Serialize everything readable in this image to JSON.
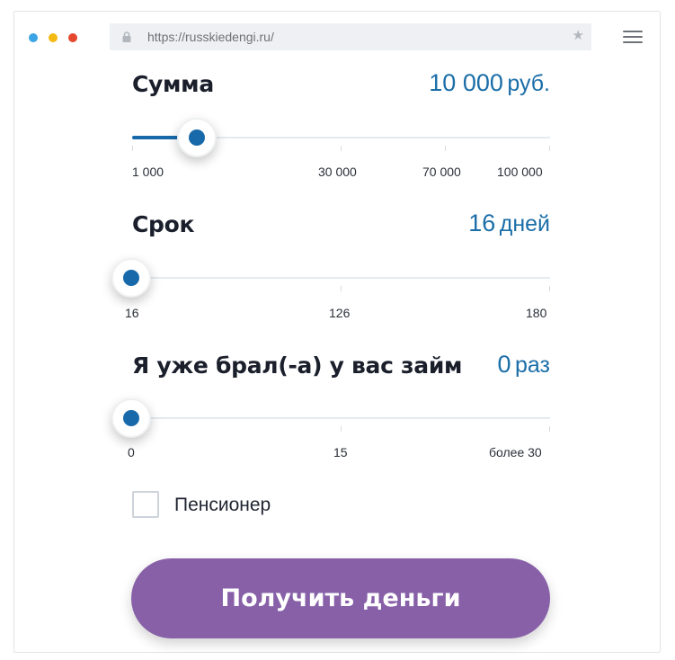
{
  "browser": {
    "url": "https://russkiedengi.ru/",
    "lock_icon": "lock-icon",
    "bookmark_icon": "star-icon",
    "menu_icon": "hamburger-menu-icon",
    "window_dots": [
      "#3ba4e4",
      "#f5b914",
      "#e5462e"
    ]
  },
  "calculator": {
    "amount": {
      "label": "Сумма",
      "value": "10 000",
      "unit": "руб.",
      "slider_value": 10000,
      "ticks": [
        "1 000",
        "30 000",
        "70 000",
        "100 000"
      ]
    },
    "term": {
      "label": "Срок",
      "value": "16",
      "unit": "дней",
      "slider_value": 16,
      "ticks": [
        "16",
        "126",
        "180"
      ]
    },
    "loans": {
      "label": "Я уже брал(-а) у вас займ",
      "value": "0",
      "unit": "раз",
      "slider_value": 0,
      "ticks": [
        "0",
        "15",
        "более 30"
      ]
    },
    "pensioner": {
      "label": "Пенсионер",
      "checked": false
    },
    "submit_label": "Получить деньги"
  },
  "colors": {
    "accent": "#1769aa",
    "button": "#8760a8",
    "value_text": "#1a6ea8"
  }
}
